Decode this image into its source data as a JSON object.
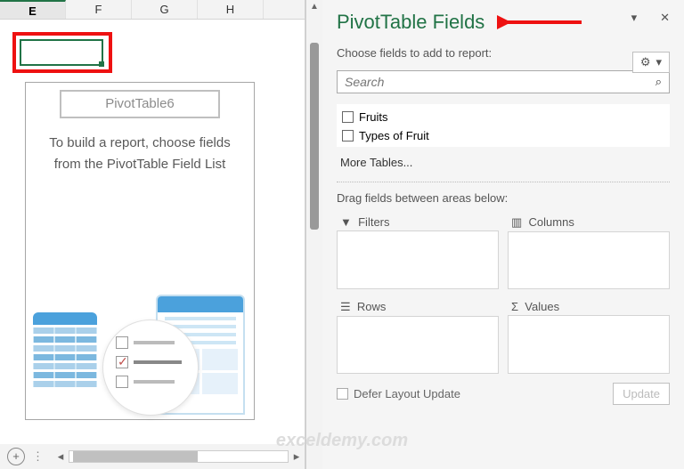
{
  "columns": [
    "E",
    "F",
    "G",
    "H"
  ],
  "active_column_index": 0,
  "pivot_placeholder": {
    "name": "PivotTable6",
    "hint": "To build a report, choose fields from the PivotTable Field List"
  },
  "right_pane": {
    "title": "PivotTable Fields",
    "choose_label": "Choose fields to add to report:",
    "search_placeholder": "Search",
    "fields": [
      {
        "label": "Fruits",
        "checked": false
      },
      {
        "label": "Types of Fruit",
        "checked": false
      }
    ],
    "more_tables": "More Tables...",
    "drag_label": "Drag fields between areas below:",
    "areas": {
      "filters": "Filters",
      "columns": "Columns",
      "rows": "Rows",
      "values": "Values"
    },
    "defer_label": "Defer Layout Update",
    "update_btn": "Update"
  },
  "watermark": "exceldemy.com",
  "icons": {
    "gear": "⚙",
    "dropdown": "▾",
    "close": "✕",
    "search": "⌕",
    "filter": "▼",
    "columns": "▥",
    "rows": "☰",
    "values": "Σ",
    "plus": "+",
    "tri_up": "▲",
    "tri_left": "◂",
    "tri_right": "▸"
  }
}
